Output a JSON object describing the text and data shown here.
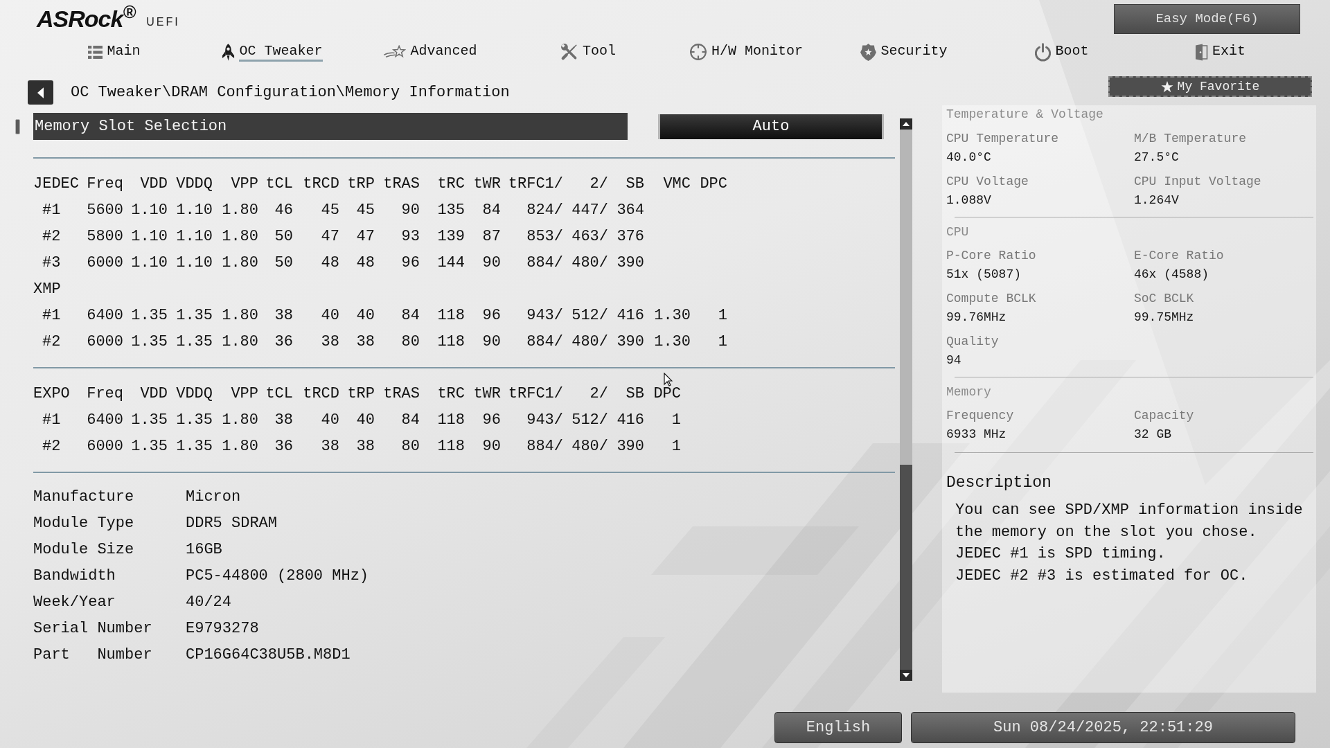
{
  "logo": {
    "brand": "ASRock$^{®}$",
    "suffix": "UEFI"
  },
  "easy_mode_button": "Easy Mode(F6)",
  "tabs": [
    {
      "label": "Main",
      "selected": false
    },
    {
      "label": "OC Tweaker",
      "selected": true
    },
    {
      "label": "Advanced",
      "selected": false
    },
    {
      "label": "Tool",
      "selected": false
    },
    {
      "label": "H/W Monitor",
      "selected": false
    },
    {
      "label": "Security",
      "selected": false
    },
    {
      "label": "Boot",
      "selected": false
    },
    {
      "label": "Exit",
      "selected": false
    }
  ],
  "breadcrumb": "OC Tweaker\\DRAM Configuration\\Memory Information",
  "favorite_button": "My Favorite",
  "setting": {
    "label": "Memory Slot Selection",
    "value": "Auto",
    "selected": true
  },
  "timing_tables": [
    {
      "columns": [
        "JEDEC",
        "Freq",
        "VDD",
        "VDDQ",
        "VPP",
        "tCL",
        "tRCD",
        "tRP",
        "tRAS",
        "tRC",
        "tWR",
        "tRFC1/",
        "2/",
        "SB",
        "VMC",
        "DPC"
      ],
      "rows": [
        [
          "#1",
          "5600",
          "1.10",
          "1.10",
          "1.80",
          "46",
          "45",
          "45",
          "90",
          "135",
          "84",
          "824/",
          "447/",
          "364"
        ],
        [
          "#2",
          "5800",
          "1.10",
          "1.10",
          "1.80",
          "50",
          "47",
          "47",
          "93",
          "139",
          "87",
          "853/",
          "463/",
          "376"
        ],
        [
          "#3",
          "6000",
          "1.10",
          "1.10",
          "1.80",
          "50",
          "48",
          "48",
          "96",
          "144",
          "90",
          "884/",
          "480/",
          "390"
        ],
        [
          "XMP"
        ],
        [
          "#1",
          "6400",
          "1.35",
          "1.35",
          "1.80",
          "38",
          "40",
          "40",
          "84",
          "118",
          "96",
          "943/",
          "512/",
          "416",
          "1.30",
          "1"
        ],
        [
          "#2",
          "6000",
          "1.35",
          "1.35",
          "1.80",
          "36",
          "38",
          "38",
          "80",
          "118",
          "90",
          "884/",
          "480/",
          "390",
          "1.30",
          "1"
        ]
      ]
    },
    {
      "columns": [
        "EXPO",
        "Freq",
        "VDD",
        "VDDQ",
        "VPP",
        "tCL",
        "tRCD",
        "tRP",
        "tRAS",
        "tRC",
        "tWR",
        "tRFC1/",
        "2/",
        "SB",
        "DPC"
      ],
      "rows": [
        [
          "#1",
          "6400",
          "1.35",
          "1.35",
          "1.80",
          "38",
          "40",
          "40",
          "84",
          "118",
          "96",
          "943/",
          "512/",
          "416",
          "1"
        ],
        [
          "#2",
          "6000",
          "1.35",
          "1.35",
          "1.80",
          "36",
          "38",
          "38",
          "80",
          "118",
          "90",
          "884/",
          "480/",
          "390",
          "1"
        ]
      ]
    }
  ],
  "module_info": [
    {
      "label": "Manufacture",
      "value": "Micron"
    },
    {
      "label": "Module Type",
      "value": "DDR5 SDRAM"
    },
    {
      "label": "Module Size",
      "value": "16GB"
    },
    {
      "label": "Bandwidth",
      "value": "PC5-44800 (2800 MHz)"
    },
    {
      "label": "Week/Year",
      "value": "40/24"
    },
    {
      "label": "Serial Number",
      "value": "E9793278"
    },
    {
      "label": "Part   Number",
      "value": "CP16G64C38U5B.M8D1"
    }
  ],
  "monitor_sections": [
    {
      "title": "Temperature & Voltage",
      "items": [
        {
          "label": "CPU Temperature",
          "value": "40.0°C"
        },
        {
          "label": "M/B Temperature",
          "value": "27.5°C"
        },
        {
          "label": "CPU Voltage",
          "value": "1.088V"
        },
        {
          "label": "CPU Input Voltage",
          "value": "1.264V"
        }
      ]
    },
    {
      "title": "CPU",
      "items": [
        {
          "label": "P-Core Ratio",
          "value": "51x (5087)"
        },
        {
          "label": "E-Core Ratio",
          "value": "46x (4588)"
        },
        {
          "label": "Compute BCLK",
          "value": "99.76MHz"
        },
        {
          "label": "SoC BCLK",
          "value": "99.75MHz"
        },
        {
          "label": "Quality",
          "value": "94"
        }
      ]
    },
    {
      "title": "Memory",
      "items": [
        {
          "label": "Frequency",
          "value": "6933 MHz"
        },
        {
          "label": "Capacity",
          "value": "32 GB"
        }
      ]
    }
  ],
  "description": {
    "title": "Description",
    "text": "You can see SPD/XMP information inside the memory on the slot you chose.\nJEDEC #1 is SPD timing.\nJEDEC #2 #3 is estimated for OC."
  },
  "language_button": "English",
  "datetime": "Sun 08/24/2025, 22:51:29"
}
